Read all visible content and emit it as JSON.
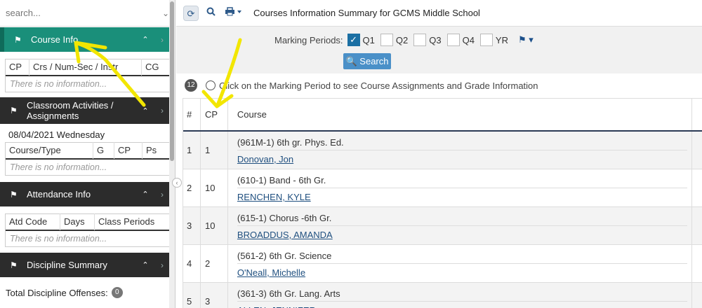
{
  "sidebar": {
    "search_placeholder": "search...",
    "course_info": {
      "title": "Course Info",
      "columns": [
        "CP",
        "Crs / Num-Sec / Instr",
        "CG"
      ],
      "empty": "There is no information..."
    },
    "classroom": {
      "title": "Classroom Activities / Assignments",
      "date": "08/04/2021 Wednesday",
      "columns": [
        "Course/Type",
        "G",
        "CP",
        "Ps"
      ],
      "empty": "There is no information..."
    },
    "attendance": {
      "title": "Attendance Info",
      "columns": [
        "Atd Code",
        "Days",
        "Class Periods"
      ],
      "empty": "There is no information..."
    },
    "discipline": {
      "title": "Discipline Summary",
      "total_label": "Total Discipline Offenses:",
      "total_count": "0"
    }
  },
  "toolbar": {
    "title": "Courses Information Summary for GCMS Middle School"
  },
  "filter": {
    "label": "Marking Periods:",
    "periods": [
      {
        "label": "Q1",
        "checked": true
      },
      {
        "label": "Q2",
        "checked": false
      },
      {
        "label": "Q3",
        "checked": false
      },
      {
        "label": "Q4",
        "checked": false
      },
      {
        "label": "YR",
        "checked": false
      }
    ],
    "search_button": "Search"
  },
  "info": {
    "count": "12",
    "text": "Click on the Marking Period to see Course Assignments and Grade Information"
  },
  "grid": {
    "headers": {
      "num": "#",
      "cp": "CP",
      "course": "Course"
    },
    "rows": [
      {
        "num": "1",
        "cp": "1",
        "course": "(961M-1) 6th gr. Phys. Ed.",
        "teacher": "Donovan, Jon"
      },
      {
        "num": "2",
        "cp": "10",
        "course": "(610-1) Band - 6th Gr.",
        "teacher": "RENCHEN, KYLE"
      },
      {
        "num": "3",
        "cp": "10",
        "course": "(615-1) Chorus -6th Gr.",
        "teacher": "BROADDUS, AMANDA"
      },
      {
        "num": "4",
        "cp": "2",
        "course": "(561-2) 6th Gr. Science",
        "teacher": "O'Neall, Michelle"
      },
      {
        "num": "5",
        "cp": "3",
        "course": "(361-3) 6th Gr. Lang. Arts",
        "teacher": "ALLEN, JENNIFER"
      }
    ]
  },
  "colors": {
    "green_header": "#1a8f7a",
    "dark_header": "#2c2c2c",
    "accent_blue": "#1b6fa3",
    "annotation": "#f2e600"
  }
}
